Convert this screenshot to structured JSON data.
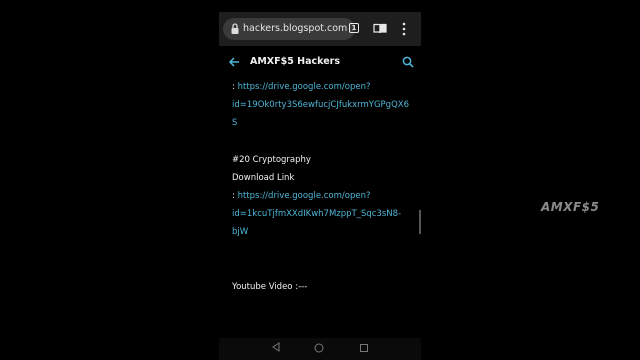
{
  "browser": {
    "url": "hackers.blogspot.com",
    "tab_count": "1"
  },
  "blog": {
    "title": "AMXF$5 Hackers"
  },
  "content": {
    "link1_prefix": ":",
    "link1_url_line1": "https://drive.google.com/open?",
    "link1_url_line2": "id=19Ok0rty3S6ewfucjCJfukxrmYGPgQX6",
    "link1_url_line3": "S",
    "section_heading": "#20 Cryptography",
    "download_label": "Download Link",
    "link2_prefix": ":",
    "link2_url_line1": "https://drive.google.com/open?",
    "link2_url_line2": "id=1kcuTjfmXXdIKwh7MzppT_Sqc3sN8-",
    "link2_url_line3": "bjW",
    "youtube_label": "Youtube Video :---"
  },
  "watermark": "AMXF$5",
  "colors": {
    "link": "#4fb6d8",
    "accent": "#4fb6d8",
    "background": "#000000"
  },
  "icons": [
    "lock-icon",
    "tabs-icon",
    "reader-mode-icon",
    "more-vert-icon",
    "back-arrow-icon",
    "search-icon",
    "nav-back-icon",
    "nav-home-icon",
    "nav-recent-icon"
  ]
}
